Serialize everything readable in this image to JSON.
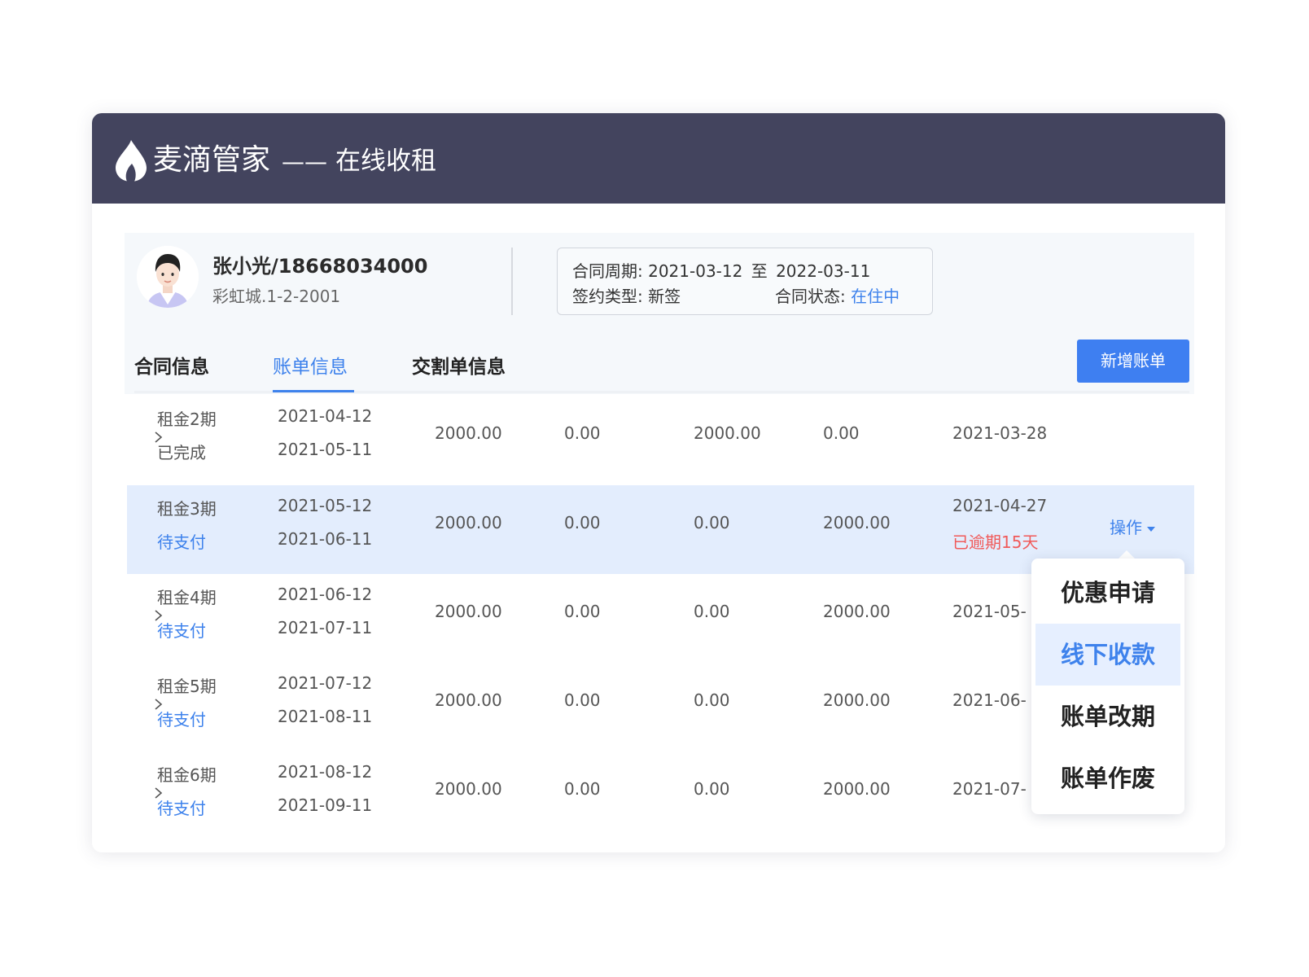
{
  "header": {
    "brand": "麦滴管家",
    "separator": "——",
    "subtitle": "在线收租",
    "logo_icon": "flame-logo-icon"
  },
  "tenant": {
    "name_phone": "张小光/18668034000",
    "address": "彩虹城.1-2-2001"
  },
  "contract": {
    "period_label": "合同周期:",
    "period_start": "2021-03-12",
    "period_to": "至",
    "period_end": "2022-03-11",
    "type_label": "签约类型:",
    "type_value": "新签",
    "status_label": "合同状态:",
    "status_value": "在住中"
  },
  "tabs": [
    {
      "label": "合同信息",
      "active": false
    },
    {
      "label": "账单信息",
      "active": true
    },
    {
      "label": "交割单信息",
      "active": false
    }
  ],
  "toolbar": {
    "add_bill_label": "新增账单"
  },
  "bills": [
    {
      "period": "租金2期",
      "status": "已完成",
      "start": "2021-04-12",
      "end": "2021-05-11",
      "col3": "2000.00",
      "col4": "0.00",
      "col5": "2000.00",
      "col6": "0.00",
      "due": "2021-03-28"
    },
    {
      "period": "租金3期",
      "status": "待支付",
      "start": "2021-05-12",
      "end": "2021-06-11",
      "col3": "2000.00",
      "col4": "0.00",
      "col5": "0.00",
      "col6": "2000.00",
      "due": "2021-04-27",
      "overdue": "已逾期15天"
    },
    {
      "period": "租金4期",
      "status": "待支付",
      "start": "2021-06-12",
      "end": "2021-07-11",
      "col3": "2000.00",
      "col4": "0.00",
      "col5": "0.00",
      "col6": "2000.00",
      "due": "2021-05-"
    },
    {
      "period": "租金5期",
      "status": "待支付",
      "start": "2021-07-12",
      "end": "2021-08-11",
      "col3": "2000.00",
      "col4": "0.00",
      "col5": "0.00",
      "col6": "2000.00",
      "due": "2021-06-"
    },
    {
      "period": "租金6期",
      "status": "待支付",
      "start": "2021-08-12",
      "end": "2021-09-11",
      "col3": "2000.00",
      "col4": "0.00",
      "col5": "0.00",
      "col6": "2000.00",
      "due": "2021-07-"
    }
  ],
  "actions": {
    "label": "操作",
    "menu": [
      "优惠申请",
      "线下收款",
      "账单改期",
      "账单作废"
    ],
    "highlighted_index": 1
  },
  "colors": {
    "header_bg": "#43445e",
    "accent": "#3e82ec",
    "overdue_red": "#f05a5a",
    "row_highlight": "#e3edfd"
  }
}
